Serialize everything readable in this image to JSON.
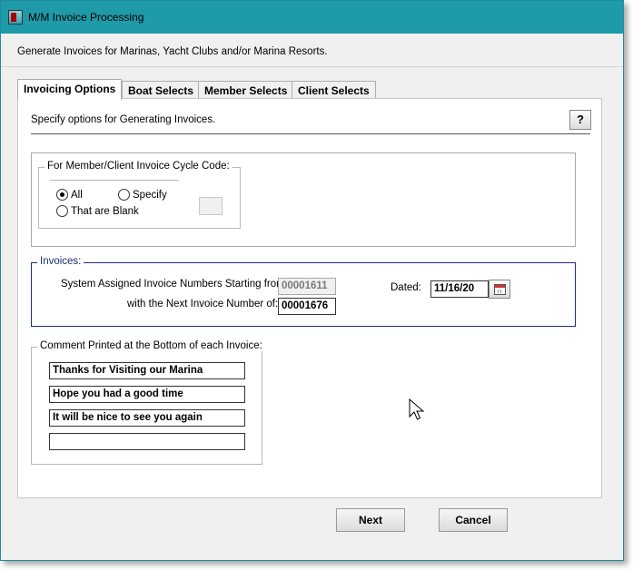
{
  "window": {
    "title": "M/M Invoice Processing",
    "subtitle": "Generate Invoices for Marinas, Yacht Clubs and/or Marina Resorts."
  },
  "tabs": [
    {
      "label": "Invoicing Options",
      "active": true
    },
    {
      "label": "Boat Selects",
      "active": false
    },
    {
      "label": "Member Selects",
      "active": false
    },
    {
      "label": "Client Selects",
      "active": false
    }
  ],
  "panel": {
    "description": "Specify options for Generating Invoices.",
    "help_icon": "help-icon"
  },
  "cycle_code": {
    "legend": "For Member/Client Invoice Cycle Code:",
    "options": [
      {
        "label": "All",
        "selected": true
      },
      {
        "label": "Specify",
        "selected": false
      },
      {
        "label": "That are Blank",
        "selected": false
      }
    ],
    "code_value": ""
  },
  "invoices": {
    "legend": "Invoices:",
    "starting_label": "System Assigned Invoice Numbers Starting from:",
    "starting_value": "00001611",
    "next_label": "with the Next Invoice Number of:",
    "next_value": "00001676",
    "dated_label": "Dated:",
    "dated_value": "11/16/20",
    "calendar_icon": "calendar-icon"
  },
  "comments": {
    "legend": "Comment Printed at the Bottom of each Invoice:",
    "lines": [
      "Thanks for Visiting our Marina",
      "Hope you had a good time",
      "It will be nice to see you again",
      ""
    ]
  },
  "buttons": {
    "next": "Next",
    "cancel": "Cancel"
  },
  "colors": {
    "titlebar": "#1e9aa8",
    "invoices_border": "#1b2f74"
  }
}
